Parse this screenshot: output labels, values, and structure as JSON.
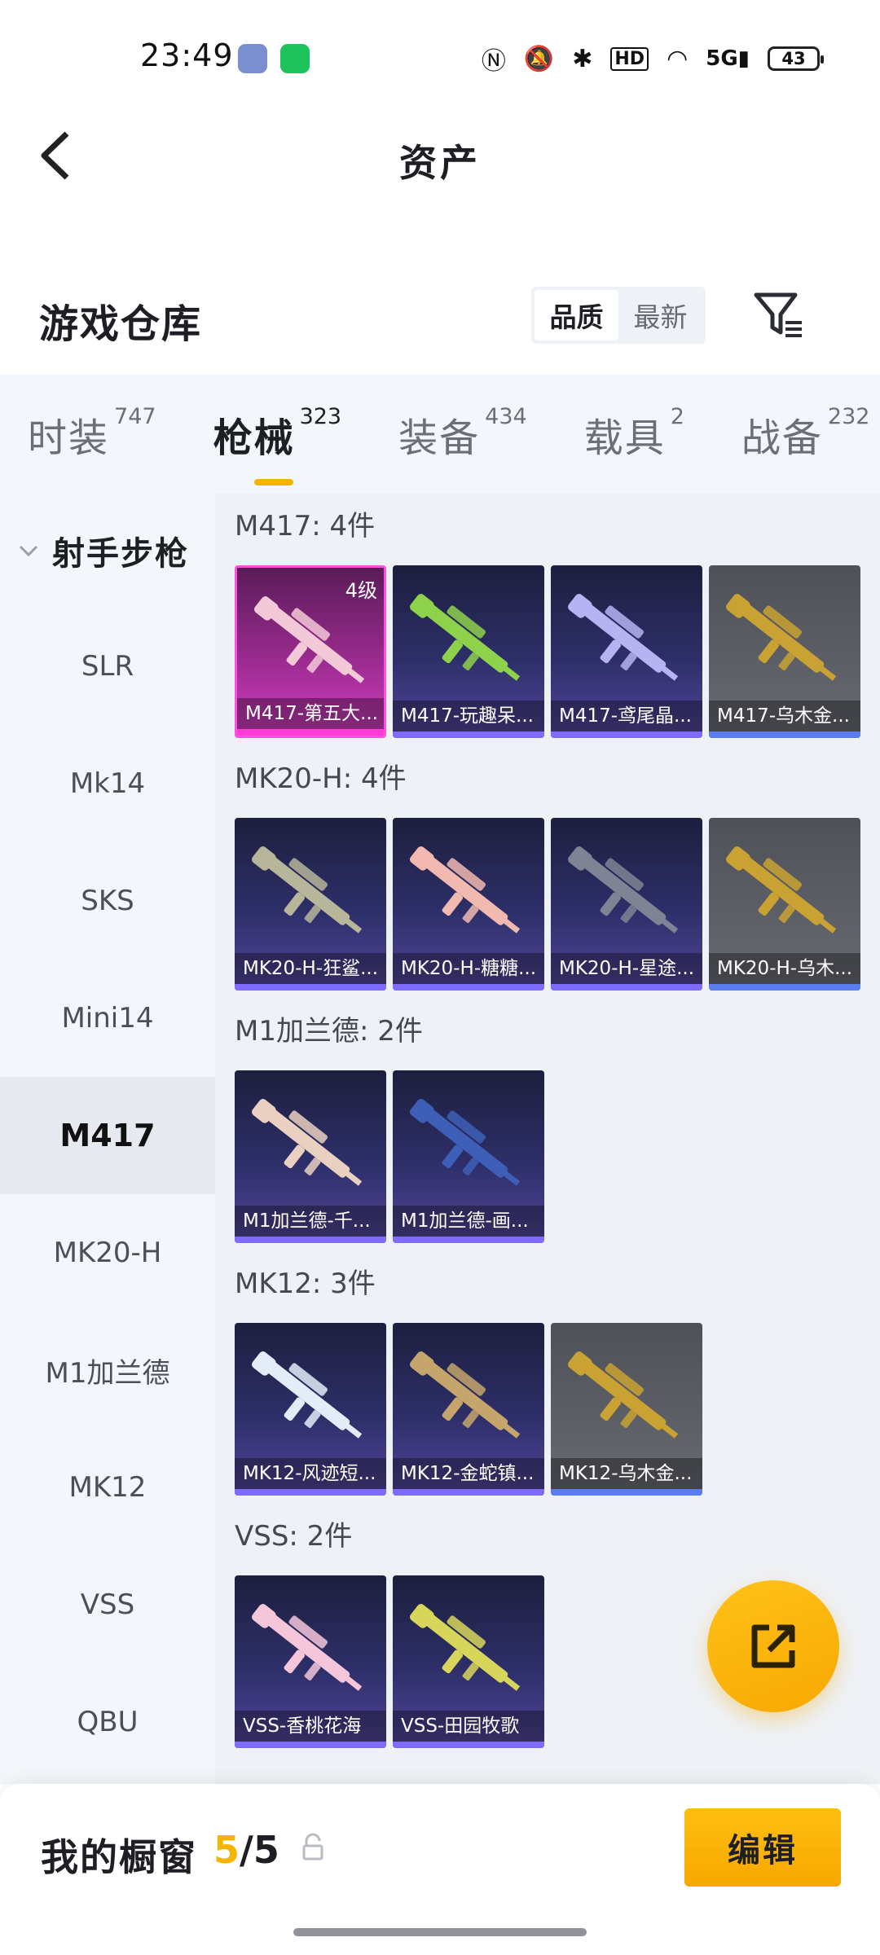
{
  "status_bar": {
    "time": "23:49",
    "icons": [
      "nfc-icon",
      "mute-icon",
      "bluetooth-icon",
      "hd-icon",
      "wifi-icon",
      "5g-signal-icon"
    ],
    "battery": "43"
  },
  "header": {
    "title": "资产"
  },
  "warehouse": {
    "title": "游戏仓库",
    "sort_options": [
      "品质",
      "最新"
    ],
    "active_sort": "品质"
  },
  "tabs": [
    {
      "label": "时装",
      "count": "747"
    },
    {
      "label": "枪械",
      "count": "323",
      "active": true
    },
    {
      "label": "装备",
      "count": "434"
    },
    {
      "label": "载具",
      "count": "2"
    },
    {
      "label": "战备",
      "count": "232"
    }
  ],
  "sidebar": {
    "category": "射手步枪",
    "items": [
      "SLR",
      "Mk14",
      "SKS",
      "Mini14",
      "M417",
      "MK20-H",
      "M1加兰德",
      "MK12",
      "VSS",
      "QBU"
    ],
    "active_item": "M417"
  },
  "groups": [
    {
      "title": "M417: 4件",
      "items": [
        {
          "name": "M417-第五大...",
          "tier": "pink",
          "level": "4级",
          "gun_color": "#f3c9d8"
        },
        {
          "name": "M417-玩趣呆...",
          "tier": "purple",
          "gun_color": "#8ed14a"
        },
        {
          "name": "M417-鸢尾晶...",
          "tier": "purple",
          "gun_color": "#b6b3f2"
        },
        {
          "name": "M417-乌木金...",
          "tier": "gray",
          "gun_color": "#c9a233"
        }
      ]
    },
    {
      "title": "MK20-H: 4件",
      "items": [
        {
          "name": "MK20-H-狂鲨...",
          "tier": "purple",
          "gun_color": "#b7b59a"
        },
        {
          "name": "MK20-H-糖糖...",
          "tier": "purple",
          "gun_color": "#f2b9b0"
        },
        {
          "name": "MK20-H-星途...",
          "tier": "purple",
          "gun_color": "#7f8494"
        },
        {
          "name": "MK20-H-乌木...",
          "tier": "gray",
          "gun_color": "#c9a233"
        }
      ]
    },
    {
      "title": "M1加兰德: 2件",
      "items": [
        {
          "name": "M1加兰德-千...",
          "tier": "purple",
          "gun_color": "#ead0c0"
        },
        {
          "name": "M1加兰德-画...",
          "tier": "purple",
          "gun_color": "#3e5fb7"
        }
      ]
    },
    {
      "title": "MK12: 3件",
      "items": [
        {
          "name": "MK12-风迹短...",
          "tier": "purple",
          "gun_color": "#e3ecf8"
        },
        {
          "name": "MK12-金蛇镇...",
          "tier": "purple",
          "gun_color": "#c5a56b"
        },
        {
          "name": "MK12-乌木金...",
          "tier": "gray",
          "gun_color": "#c9a233"
        }
      ]
    },
    {
      "title": "VSS: 2件",
      "items": [
        {
          "name": "VSS-香桃花海",
          "tier": "purple",
          "gun_color": "#f5c6da"
        },
        {
          "name": "VSS-田园牧歌",
          "tier": "purple",
          "gun_color": "#d8d65a"
        }
      ]
    }
  ],
  "bottom_bar": {
    "showcase_label": "我的橱窗",
    "showcase_count": "5",
    "showcase_total": "/5",
    "edit_label": "编辑"
  },
  "colors": {
    "accent": "#f5b400",
    "purple_strip": "#7d6cff",
    "pink_tier": "#ff3ad6"
  }
}
